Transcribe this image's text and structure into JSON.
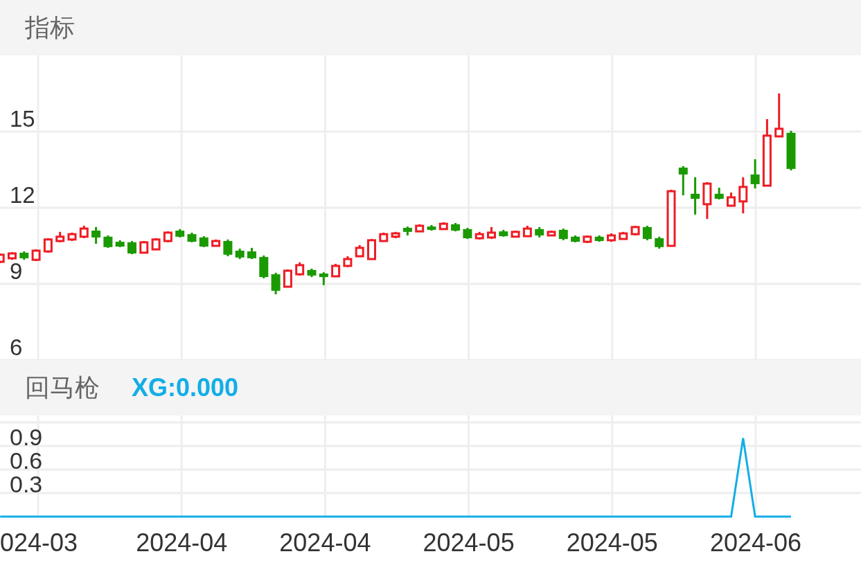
{
  "price_panel": {
    "title": "指标",
    "chart_data": {
      "type": "candlestick",
      "ylim": [
        6,
        18
      ],
      "yticks": [
        15,
        12,
        9,
        6
      ],
      "grid": true,
      "ohlc": [
        [
          9.87,
          10.2,
          9.82,
          10.15
        ],
        [
          10.01,
          10.25,
          9.95,
          10.2
        ],
        [
          10.23,
          10.28,
          9.95,
          10.01
        ],
        [
          9.95,
          10.36,
          9.9,
          10.31
        ],
        [
          10.28,
          10.8,
          10.23,
          10.75
        ],
        [
          10.69,
          11.05,
          10.64,
          10.86
        ],
        [
          10.75,
          11.02,
          10.69,
          10.96
        ],
        [
          10.86,
          11.29,
          10.8,
          11.18
        ],
        [
          11.1,
          11.24,
          10.58,
          10.83
        ],
        [
          10.86,
          10.91,
          10.42,
          10.45
        ],
        [
          10.66,
          10.72,
          10.45,
          10.47
        ],
        [
          10.64,
          10.69,
          10.17,
          10.2
        ],
        [
          10.23,
          10.69,
          10.2,
          10.64
        ],
        [
          10.36,
          10.8,
          10.34,
          10.75
        ],
        [
          10.69,
          11.07,
          10.64,
          11.02
        ],
        [
          11.1,
          11.16,
          10.83,
          10.86
        ],
        [
          10.96,
          11.02,
          10.64,
          10.66
        ],
        [
          10.83,
          10.88,
          10.45,
          10.47
        ],
        [
          10.5,
          10.75,
          10.47,
          10.69
        ],
        [
          10.69,
          10.75,
          10.09,
          10.15
        ],
        [
          10.31,
          10.39,
          9.98,
          10.04
        ],
        [
          10.28,
          10.42,
          9.98,
          10.01
        ],
        [
          10.06,
          10.12,
          9.22,
          9.27
        ],
        [
          9.38,
          9.44,
          8.59,
          8.73
        ],
        [
          8.89,
          9.57,
          8.86,
          9.52
        ],
        [
          9.38,
          9.85,
          9.33,
          9.74
        ],
        [
          9.55,
          9.6,
          9.27,
          9.33
        ],
        [
          9.41,
          9.46,
          8.95,
          9.27
        ],
        [
          9.3,
          9.79,
          9.27,
          9.71
        ],
        [
          9.71,
          10.09,
          9.66,
          9.98
        ],
        [
          10.09,
          10.53,
          10.06,
          10.42
        ],
        [
          9.98,
          10.77,
          9.95,
          10.72
        ],
        [
          10.69,
          11.02,
          10.66,
          10.96
        ],
        [
          10.86,
          11.05,
          10.8,
          10.99
        ],
        [
          11.21,
          11.26,
          10.91,
          11.05
        ],
        [
          11.07,
          11.35,
          11.05,
          11.29
        ],
        [
          11.26,
          11.32,
          11.1,
          11.13
        ],
        [
          11.16,
          11.43,
          11.13,
          11.37
        ],
        [
          11.35,
          11.4,
          11.07,
          11.1
        ],
        [
          11.16,
          11.21,
          10.77,
          10.8
        ],
        [
          10.8,
          11.05,
          10.75,
          10.96
        ],
        [
          10.83,
          11.24,
          10.77,
          11.02
        ],
        [
          11.07,
          11.13,
          10.86,
          10.88
        ],
        [
          10.86,
          11.1,
          10.83,
          11.05
        ],
        [
          10.88,
          11.29,
          10.86,
          11.18
        ],
        [
          11.16,
          11.24,
          10.83,
          10.91
        ],
        [
          10.91,
          11.1,
          10.88,
          11.05
        ],
        [
          11.13,
          11.18,
          10.72,
          10.77
        ],
        [
          10.86,
          10.91,
          10.64,
          10.66
        ],
        [
          10.66,
          10.91,
          10.61,
          10.86
        ],
        [
          10.86,
          10.91,
          10.66,
          10.69
        ],
        [
          10.72,
          10.99,
          10.66,
          10.91
        ],
        [
          10.77,
          11.05,
          10.75,
          10.99
        ],
        [
          10.96,
          11.29,
          10.91,
          11.24
        ],
        [
          11.24,
          11.29,
          10.72,
          10.77
        ],
        [
          10.8,
          10.86,
          10.39,
          10.45
        ],
        [
          10.5,
          12.71,
          10.47,
          12.65
        ],
        [
          13.58,
          13.64,
          12.49,
          13.31
        ],
        [
          12.55,
          13.2,
          11.73,
          12.35
        ],
        [
          12.14,
          13.01,
          11.56,
          12.95
        ],
        [
          12.55,
          12.79,
          12.33,
          12.35
        ],
        [
          12.08,
          12.6,
          12.05,
          12.41
        ],
        [
          12.25,
          13.2,
          11.78,
          12.82
        ],
        [
          13.31,
          13.91,
          12.76,
          12.93
        ],
        [
          12.87,
          15.49,
          12.85,
          14.84
        ],
        [
          14.81,
          16.5,
          14.78,
          15.11
        ],
        [
          14.95,
          15.03,
          13.47,
          13.53
        ]
      ]
    }
  },
  "indicator_panel": {
    "title": "回马枪",
    "value_label": "XG:0.000",
    "chart_data": {
      "type": "line",
      "grid": true,
      "ylim": [
        0,
        1.2
      ],
      "yticks": [
        0.3,
        0.6,
        0.9
      ],
      "series": [
        {
          "color": "#12aee6",
          "values": [
            0,
            0,
            0,
            0,
            0,
            0,
            0,
            0,
            0,
            0,
            0,
            0,
            0,
            0,
            0,
            0,
            0,
            0,
            0,
            0,
            0,
            0,
            0,
            0,
            0,
            0,
            0,
            0,
            0,
            0,
            0,
            0,
            0,
            0,
            0,
            0,
            0,
            0,
            0,
            0,
            0,
            0,
            0,
            0,
            0,
            0,
            0,
            0,
            0,
            0,
            0,
            0,
            0,
            0,
            0,
            0,
            0,
            0,
            0,
            0,
            0,
            0,
            1,
            0,
            0,
            0,
            0
          ]
        }
      ]
    }
  },
  "x_axis": {
    "labels": [
      "024-03",
      "2024-04",
      "2024-04",
      "2024-05",
      "2024-05",
      "2024-06"
    ]
  }
}
